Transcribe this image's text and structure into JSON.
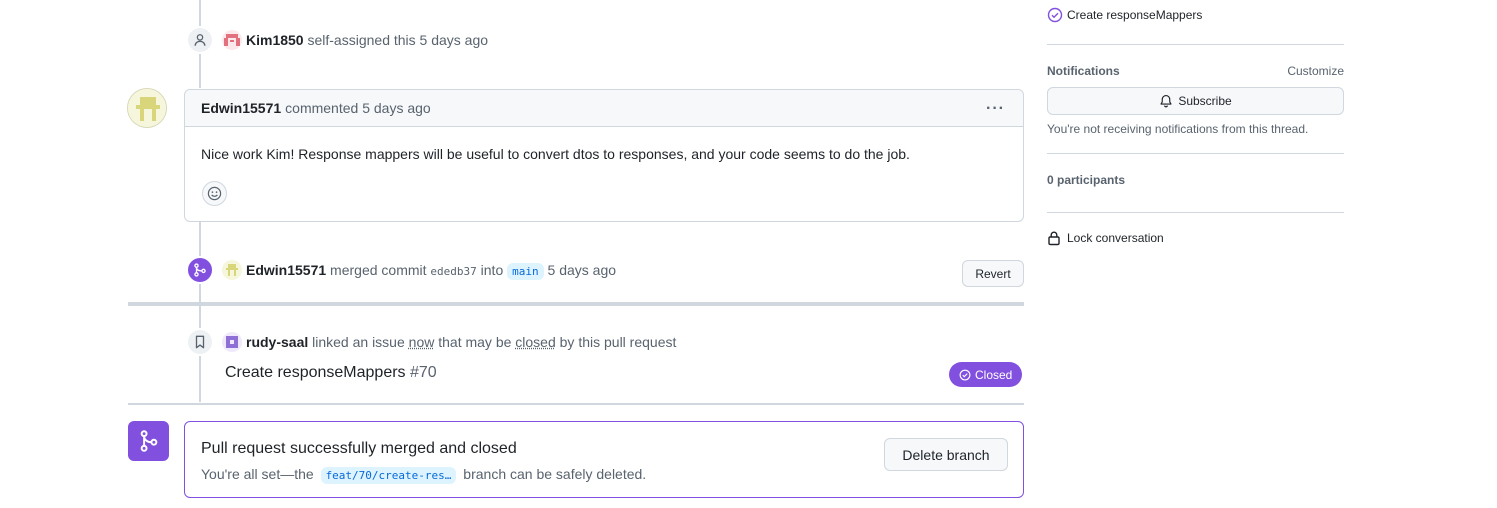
{
  "timeline": {
    "assign_event": {
      "actor": "Kim1850",
      "text": "self-assigned this 5 days ago"
    },
    "comment": {
      "author": "Edwin15571",
      "meta": "commented 5 days ago",
      "body": "Nice work Kim! Response mappers will be useful to convert dtos to responses, and your code seems to do the job."
    },
    "merge_event": {
      "actor": "Edwin15571",
      "text_before": "merged commit",
      "commit": "ededb37",
      "text_into": "into",
      "branch": "main",
      "time": "5 days ago",
      "revert_label": "Revert"
    },
    "link_event": {
      "actor": "rudy-saal",
      "text_before": "linked an issue",
      "now": "now",
      "text_mid": "that may be",
      "closed": "closed",
      "text_after": "by this pull request",
      "issue_title": "Create responseMappers",
      "issue_number": "#70",
      "status_label": "Closed"
    },
    "merged_box": {
      "title": "Pull request successfully merged and closed",
      "sub_before": "You're all set—the",
      "branch": "feat/70/create-res…",
      "sub_after": "branch can be safely deleted.",
      "delete_label": "Delete branch"
    }
  },
  "sidebar": {
    "linked_issue": "Create responseMappers",
    "notifications_heading": "Notifications",
    "customize_label": "Customize",
    "subscribe_label": "Subscribe",
    "notifications_note": "You're not receiving notifications from this thread.",
    "participants": "0 participants",
    "lock_label": "Lock conversation"
  },
  "colors": {
    "accent_purple": "#8250df",
    "border": "#d0d7de",
    "muted_text": "#59636e"
  }
}
